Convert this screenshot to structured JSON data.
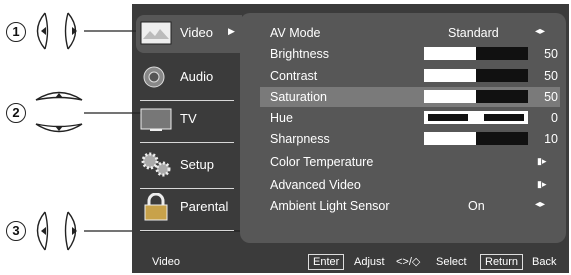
{
  "callouts": {
    "one": "1",
    "two": "2",
    "three": "3"
  },
  "menu": {
    "tabs": [
      {
        "label": "Video",
        "icon": "video-icon",
        "active": true
      },
      {
        "label": "Audio",
        "icon": "audio-icon"
      },
      {
        "label": "TV",
        "icon": "tv-icon"
      },
      {
        "label": "Setup",
        "icon": "setup-gears-icon"
      },
      {
        "label": "Parental",
        "icon": "lock-icon"
      }
    ],
    "items": [
      {
        "name": "AV Mode",
        "value": "Standard",
        "control": "left-right"
      },
      {
        "name": "Brightness",
        "value": "50",
        "level": 0.5
      },
      {
        "name": "Contrast",
        "value": "50",
        "level": 0.5
      },
      {
        "name": "Saturation",
        "value": "50",
        "level": 0.5,
        "selected": true
      },
      {
        "name": "Hue",
        "value": "0",
        "level": 0.5,
        "center": true
      },
      {
        "name": "Sharpness",
        "value": "10",
        "level": 0.5
      },
      {
        "name": "Color Temperature",
        "control": "right"
      },
      {
        "name": "Advanced Video",
        "control": "right"
      },
      {
        "name": "Ambient Light Sensor",
        "value": "On",
        "control": "left-right"
      }
    ]
  },
  "footer": {
    "section": "Video",
    "enter_key": "Enter",
    "adjust_label": "Adjust",
    "select_label": "Select",
    "return_key": "Return",
    "back_label": "Back"
  },
  "colors": {
    "screen": "#3b3b3b",
    "panel": "#575757",
    "selected_row": "#7a7a7a"
  }
}
